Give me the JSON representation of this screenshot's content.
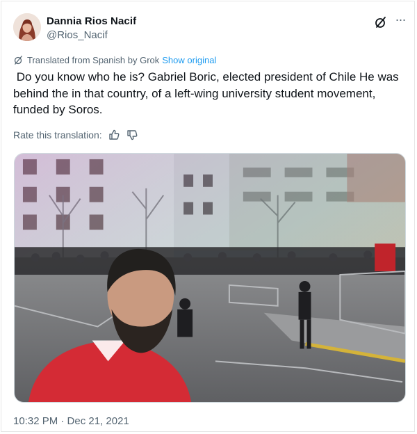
{
  "author": {
    "display_name": "Dannia Rios Nacif",
    "handle": "@Rios_Nacif"
  },
  "icons": {
    "avatar": "profile-photo",
    "grok": "grok-slash-icon",
    "more": "more-dots-icon",
    "translate": "grok-slash-icon",
    "thumbs_up": "thumbs-up-icon",
    "thumbs_down": "thumbs-down-icon"
  },
  "translation": {
    "label": "Translated from Spanish by Grok",
    "show_original": "Show original"
  },
  "tweet": {
    "text": " Do you know who he is? Gabriel Boric, elected president of Chile He was behind the in that country, of a left-wing university student movement, funded by Soros."
  },
  "rating": {
    "label": "Rate this translation:"
  },
  "media": {
    "description_icon": "photo"
  },
  "meta": {
    "timestamp": "10:32 PM · Dec 21, 2021"
  },
  "colors": {
    "accent": "#1d9bf0",
    "secondary_text": "#536471",
    "primary_text": "#0f1419"
  }
}
